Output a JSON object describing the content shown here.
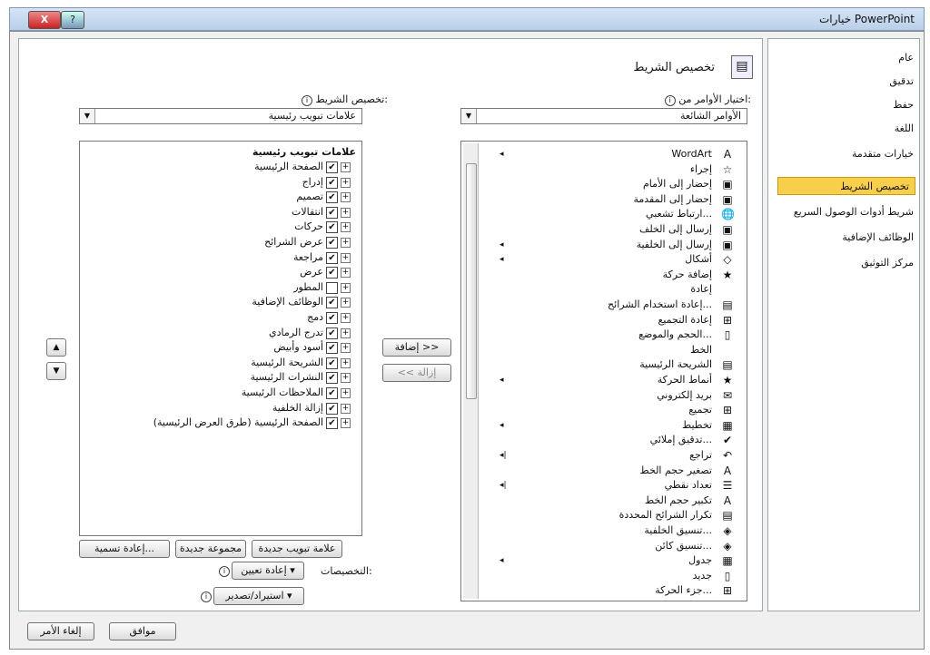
{
  "window": {
    "title": "خيارات PowerPoint",
    "close_label": "X",
    "help_label": "?"
  },
  "nav": {
    "items": [
      {
        "label": "عام"
      },
      {
        "label": "تدقيق"
      },
      {
        "label": "حفظ"
      },
      {
        "label": "اللغة"
      },
      {
        "label": "خيارات متقدمة"
      },
      {
        "label": "تخصيص الشريط"
      },
      {
        "label": "شريط أدوات الوصول السريع"
      },
      {
        "label": "الوظائف الإضافية"
      },
      {
        "label": "مركز التوثيق"
      }
    ],
    "active_index": 5
  },
  "header": {
    "title": "تخصيص الشريط"
  },
  "choose": {
    "label": "اختيار الأوامر من:",
    "value": "الأوامر الشائعة"
  },
  "customize": {
    "label": "تخصيص الشريط:",
    "value": "علامات تبويب رئيسية"
  },
  "commands": [
    {
      "label": "WordArt",
      "icon": "A",
      "sub": "◂"
    },
    {
      "label": "إجراء",
      "icon": "☆",
      "sub": ""
    },
    {
      "label": "إحضار إلى الأمام",
      "icon": "▣",
      "sub": ""
    },
    {
      "label": "إحضار إلى المقدمة",
      "icon": "▣",
      "sub": ""
    },
    {
      "label": "ارتباط تشعبي...",
      "icon": "🌐",
      "sub": ""
    },
    {
      "label": "إرسال إلى الخلف",
      "icon": "▣",
      "sub": ""
    },
    {
      "label": "إرسال إلى الخلفية",
      "icon": "▣",
      "sub": "◂"
    },
    {
      "label": "أشكال",
      "icon": "◇",
      "sub": "◂"
    },
    {
      "label": "إضافة حركة",
      "icon": "★",
      "sub": ""
    },
    {
      "label": "إعادة",
      "icon": "",
      "sub": ""
    },
    {
      "label": "إعادة استخدام الشرائح...",
      "icon": "▤",
      "sub": ""
    },
    {
      "label": "إعادة التجميع",
      "icon": "⊞",
      "sub": ""
    },
    {
      "label": "الحجم والموضع...",
      "icon": "▯",
      "sub": ""
    },
    {
      "label": "الخط",
      "icon": "",
      "sub": ""
    },
    {
      "label": "الشريحة الرئيسية",
      "icon": "▤",
      "sub": ""
    },
    {
      "label": "أنماط الحركة",
      "icon": "★",
      "sub": "◂"
    },
    {
      "label": "بريد إلكتروني",
      "icon": "✉",
      "sub": ""
    },
    {
      "label": "تجميع",
      "icon": "⊞",
      "sub": ""
    },
    {
      "label": "تخطيط",
      "icon": "▦",
      "sub": "◂"
    },
    {
      "label": "تدقيق إملائي...",
      "icon": "✔",
      "sub": ""
    },
    {
      "label": "تراجع",
      "icon": "↶",
      "sub": "◂|"
    },
    {
      "label": "تصغير حجم الخط",
      "icon": "A",
      "sub": ""
    },
    {
      "label": "تعداد نقطي",
      "icon": "☰",
      "sub": "◂|"
    },
    {
      "label": "تكبير حجم الخط",
      "icon": "A",
      "sub": ""
    },
    {
      "label": "تكرار الشرائح المحددة",
      "icon": "▤",
      "sub": ""
    },
    {
      "label": "تنسيق الخلفية...",
      "icon": "◈",
      "sub": ""
    },
    {
      "label": "تنسيق كائن...",
      "icon": "◈",
      "sub": ""
    },
    {
      "label": "جدول",
      "icon": "▦",
      "sub": "◂"
    },
    {
      "label": "جديد",
      "icon": "▯",
      "sub": ""
    },
    {
      "label": "جزء الحركة...",
      "icon": "⊞",
      "sub": ""
    }
  ],
  "tabs_tree": {
    "header": "علامات تبويب رئيسية",
    "items": [
      {
        "label": "الصفحة الرئيسية",
        "checked": "✔"
      },
      {
        "label": "إدراج",
        "checked": "✔"
      },
      {
        "label": "تصميم",
        "checked": "✔"
      },
      {
        "label": "انتقالات",
        "checked": "✔"
      },
      {
        "label": "حركات",
        "checked": "✔"
      },
      {
        "label": "عرض الشرائح",
        "checked": "✔"
      },
      {
        "label": "مراجعة",
        "checked": "✔"
      },
      {
        "label": "عرض",
        "checked": "✔"
      },
      {
        "label": "المطور",
        "checked": ""
      },
      {
        "label": "الوظائف الإضافية",
        "checked": "✔"
      },
      {
        "label": "دمج",
        "checked": "✔"
      },
      {
        "label": "تدرج الرمادي",
        "checked": "✔"
      },
      {
        "label": "أسود وأبيض",
        "checked": "✔"
      },
      {
        "label": "الشريحة الرئيسية",
        "checked": "✔"
      },
      {
        "label": "النشرات الرئيسية",
        "checked": "✔"
      },
      {
        "label": "الملاحظات الرئيسية",
        "checked": "✔"
      },
      {
        "label": "إزالة الخلفية",
        "checked": "✔"
      },
      {
        "label": "الصفحة الرئيسية (طرق العرض الرئيسية)",
        "checked": "✔"
      }
    ]
  },
  "middle": {
    "add": "إضافة >>",
    "remove": "<< إزالة"
  },
  "bottom": {
    "new_tab": "علامة تبويب جديدة",
    "new_group": "مجموعة جديدة",
    "rename": "إعادة تسمية...",
    "customizations_label": "التخصيصات:",
    "reset": "إعادة تعيين ▾",
    "import_export": "استيراد/تصدير ▾"
  },
  "footer": {
    "ok": "موافق",
    "cancel": "إلغاء الأمر"
  },
  "glyphs": {
    "info": "i",
    "up": "▲",
    "down": "▼",
    "combo": "▼",
    "expand": "⊞",
    "expand_sign": "+"
  }
}
